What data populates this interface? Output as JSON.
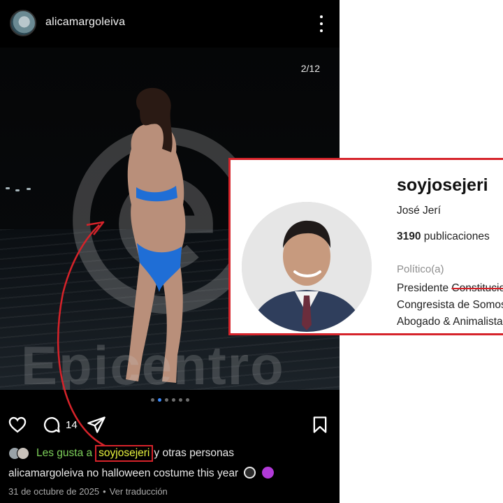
{
  "post": {
    "header": {
      "username": "alicamargoleiva"
    },
    "photo": {
      "counter": "2/12",
      "watermark": "Epicentro",
      "carousel_dots": 6,
      "active_dot": 1
    },
    "actions": {
      "comment_count": "14"
    },
    "likes": {
      "prefix": "Les gusta a",
      "liker": "soyjosejeri",
      "suffix": "y otras personas"
    },
    "caption": {
      "username": "alicamargoleiva",
      "text": "no halloween costume this year"
    },
    "meta": {
      "date": "31 de octubre de 2025",
      "separator": "•",
      "translate": "Ver traducción"
    }
  },
  "profile_card": {
    "username": "soyjosejeri",
    "full_name": "José Jerí",
    "posts_count": "3190",
    "posts_label": "publicaciones",
    "category": "Político(a)",
    "bio": {
      "line1_start": "Presidente ",
      "line1_struck": "Constitucional",
      "line2": "Congresista de Somos Perú",
      "line3": "Abogado & Animalista"
    }
  },
  "colors": {
    "highlight_red": "#d6232a",
    "liker_yellow": "#e8f43e",
    "likes_green": "#7dd05a",
    "carousel_active": "#3b8bff"
  },
  "icons": [
    "more-vertical-icon",
    "heart-icon",
    "comment-icon",
    "share-icon",
    "bookmark-icon",
    "ninja-emoji",
    "devil-emoji"
  ]
}
